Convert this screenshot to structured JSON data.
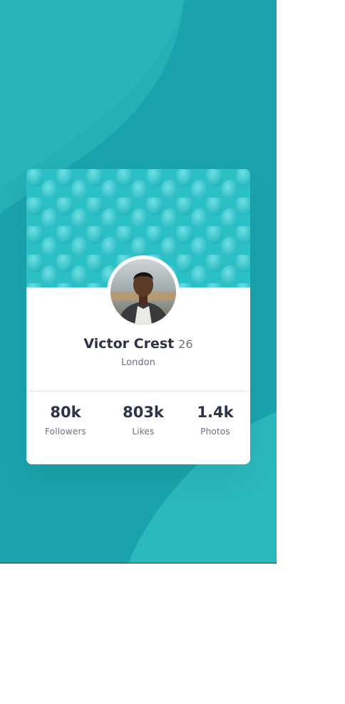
{
  "colors": {
    "page_bg": "#1aa3ad",
    "wave_light": "#2bb8bd",
    "card_bg": "#ffffff",
    "text_dark": "#2e3349",
    "text_muted": "#6b7082"
  },
  "profile": {
    "name": "Victor Crest",
    "age": "26",
    "location": "London",
    "avatar_icon": "person-photo"
  },
  "stats": [
    {
      "value": "80k",
      "label": "Followers"
    },
    {
      "value": "803k",
      "label": "Likes"
    },
    {
      "value": "1.4k",
      "label": "Photos"
    }
  ]
}
